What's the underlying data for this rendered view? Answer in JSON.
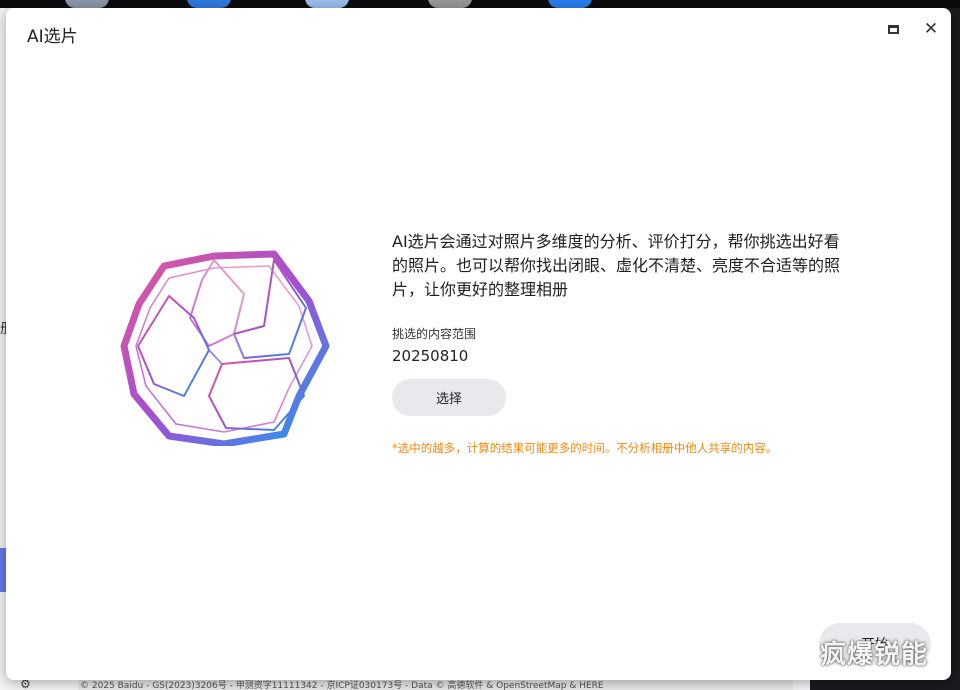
{
  "dialog": {
    "title": "AI选片",
    "description": "AI选片会通过对照片多维度的分析、评价打分，帮你挑选出好看的照片。也可以帮你找出闭眼、虚化不清楚、亮度不合适等的照片，让你更好的整理相册",
    "range_label": "挑选的内容范围",
    "range_value": "20250810",
    "select_button": "选择",
    "note": "*选中的越多，计算的结果可能更多的时间。不分析相册中他人共享的内容。",
    "bottom_button": "开始"
  },
  "icons": {
    "maximize": "maximize-icon",
    "close": "close-icon",
    "close_glyph": "✕",
    "logo": "ai-cube-logo",
    "gear": "gear-icon",
    "gear_glyph": "⚙"
  },
  "background": {
    "side_char": "册",
    "footer_text": "© 2025 Baidu - GS(2023)3206号 - 甲测资字11111342 - 京ICP证030173号 - Data © 高德软件 & OpenStreetMap & HERE"
  },
  "watermark": "疯爆锐能",
  "colors": {
    "logo_gradient_start": "#e0589a",
    "logo_gradient_mid": "#a34fd2",
    "logo_gradient_end": "#1e9bf0",
    "note_color": "#f0890f",
    "button_bg": "#e8e9ed"
  }
}
